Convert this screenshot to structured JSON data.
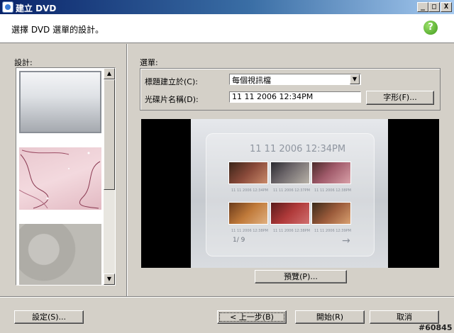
{
  "window": {
    "title": "建立 DVD"
  },
  "caption_buttons": {
    "minimize": "_",
    "maximize": "□",
    "close": "X"
  },
  "header": {
    "text": "選擇 DVD 選單的設計。",
    "help_label": "?"
  },
  "design": {
    "label": "設計:"
  },
  "menu": {
    "group_label": "選單:",
    "title_from_label": "標題建立於(C):",
    "title_from_value": "每個視訊檔",
    "disc_name_label": "光碟片名稱(D):",
    "disc_name_value": "11 11 2006  12:34PM",
    "font_button": "字形(F)..."
  },
  "preview": {
    "menu_title": "11 11 2006  12:34PM",
    "clips": [
      {
        "caption": "11 11 2006 12:34PM"
      },
      {
        "caption": "11 11 2006 12:37PM"
      },
      {
        "caption": "11 11 2006 12:38PM"
      },
      {
        "caption": "11 11 2006 12:38PM"
      },
      {
        "caption": "11 11 2006 12:38PM"
      },
      {
        "caption": "11 11 2006 12:39PM"
      }
    ],
    "page_indicator": "1/  9",
    "next_arrow": "→",
    "preview_button": "預覽(P)..."
  },
  "footer": {
    "settings_button": "設定(S)...",
    "back_button": "< 上一步(B)",
    "start_button": "開始(R)",
    "cancel_button": "取消"
  },
  "watermark": "#60845",
  "colors": {
    "titlebar": "#0a246a",
    "help": "#3f9a1a",
    "dialog": "#d4d0c8"
  }
}
